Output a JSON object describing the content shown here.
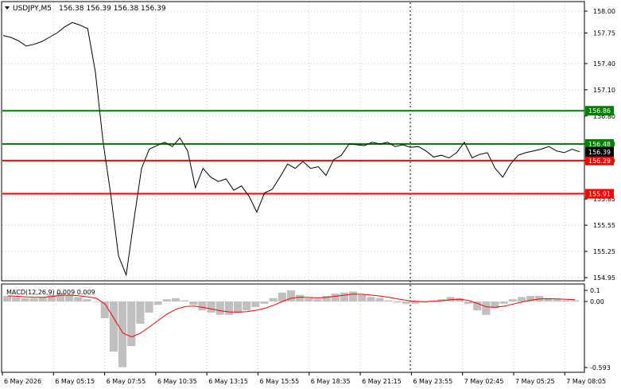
{
  "header": {
    "symbol_label": "USDJPY,M5",
    "ohlc": "156.38 156.39 156.38 156.39",
    "collapse_icon": "triangle-down-icon"
  },
  "macd": {
    "label": "MACD(12,26,9) 0.009 0.009",
    "axis_labels": [
      "0.1",
      "0.00",
      "-0.593"
    ],
    "histogram_color": "#c0c0c0",
    "signal_color": "#ff0000"
  },
  "price_axis": {
    "labels": [
      "158.00",
      "157.75",
      "157.40",
      "157.10",
      "156.80",
      "156.48",
      "156.29",
      "155.85",
      "155.55",
      "155.25",
      "154.95"
    ],
    "current_price": "156.39"
  },
  "levels": [
    {
      "name": "resistance-high",
      "price": 156.86,
      "label": "156.86",
      "color": "#008000"
    },
    {
      "name": "resistance-low",
      "price": 156.48,
      "label": "156.48",
      "color": "#008000"
    },
    {
      "name": "support-high",
      "price": 156.29,
      "label": "156.29",
      "color": "#ff0000"
    },
    {
      "name": "support-low",
      "price": 155.91,
      "label": "155.91",
      "color": "#ff0000"
    }
  ],
  "time_axis": {
    "labels": [
      "6 May 2026",
      "6 May 05:15",
      "6 May 07:55",
      "6 May 10:35",
      "6 May 13:15",
      "6 May 15:55",
      "6 May 18:35",
      "6 May 21:15",
      "6 May 23:55",
      "7 May 02:45",
      "7 May 05:25",
      "7 May 08:05"
    ]
  },
  "colors": {
    "background": "#ffffff",
    "grid": "#c8c8c8",
    "price_line": "#000000",
    "current_price_box": "#000000",
    "separator_line": "#000000"
  },
  "chart_data": {
    "type": "line",
    "title": "USDJPY,M5",
    "ylim": [
      154.95,
      158.0
    ],
    "series": [
      {
        "values": [
          157.72,
          157.7,
          157.66,
          157.6,
          157.62,
          157.65,
          157.7,
          157.75,
          157.82,
          157.87,
          157.84,
          157.8,
          157.3,
          156.5,
          155.9,
          155.2,
          154.98,
          155.6,
          156.2,
          156.42,
          156.46,
          156.5,
          156.45,
          156.55,
          156.4,
          155.98,
          156.2,
          156.1,
          156.05,
          156.08,
          155.95,
          156.0,
          155.88,
          155.7,
          155.92,
          155.96,
          156.1,
          156.25,
          156.2,
          156.28,
          156.2,
          156.22,
          156.12,
          156.3,
          156.35,
          156.48,
          156.47,
          156.46,
          156.5,
          156.48,
          156.5,
          156.45,
          156.47,
          156.44,
          156.45,
          156.4,
          156.33,
          156.35,
          156.32,
          156.38,
          156.5,
          156.32,
          156.36,
          156.38,
          156.2,
          156.1,
          156.25,
          156.35,
          156.38,
          156.4,
          156.42,
          156.45,
          156.4,
          156.38,
          156.42,
          156.39
        ]
      },
      {
        "name": "MACD",
        "values": [
          0.05,
          0.04,
          0.03,
          0.03,
          0.04,
          0.06,
          0.08,
          0.06,
          0.04,
          0.02,
          0.0,
          -0.15,
          -0.45,
          -0.59,
          -0.4,
          -0.2,
          -0.1,
          -0.03,
          0.02,
          0.03,
          0.01,
          -0.03,
          -0.08,
          -0.1,
          -0.12,
          -0.12,
          -0.1,
          -0.08,
          -0.05,
          -0.02,
          0.03,
          0.08,
          0.1,
          0.06,
          0.03,
          0.02,
          0.05,
          0.07,
          0.08,
          0.09,
          0.06,
          0.04,
          0.03,
          0.01,
          -0.01,
          -0.02,
          -0.02,
          -0.01,
          0.01,
          0.02,
          0.04,
          0.03,
          -0.02,
          -0.08,
          -0.12,
          -0.06,
          -0.02,
          0.02,
          0.04,
          0.05,
          0.05,
          0.03,
          0.02,
          0.01,
          0.01
        ]
      }
    ]
  }
}
